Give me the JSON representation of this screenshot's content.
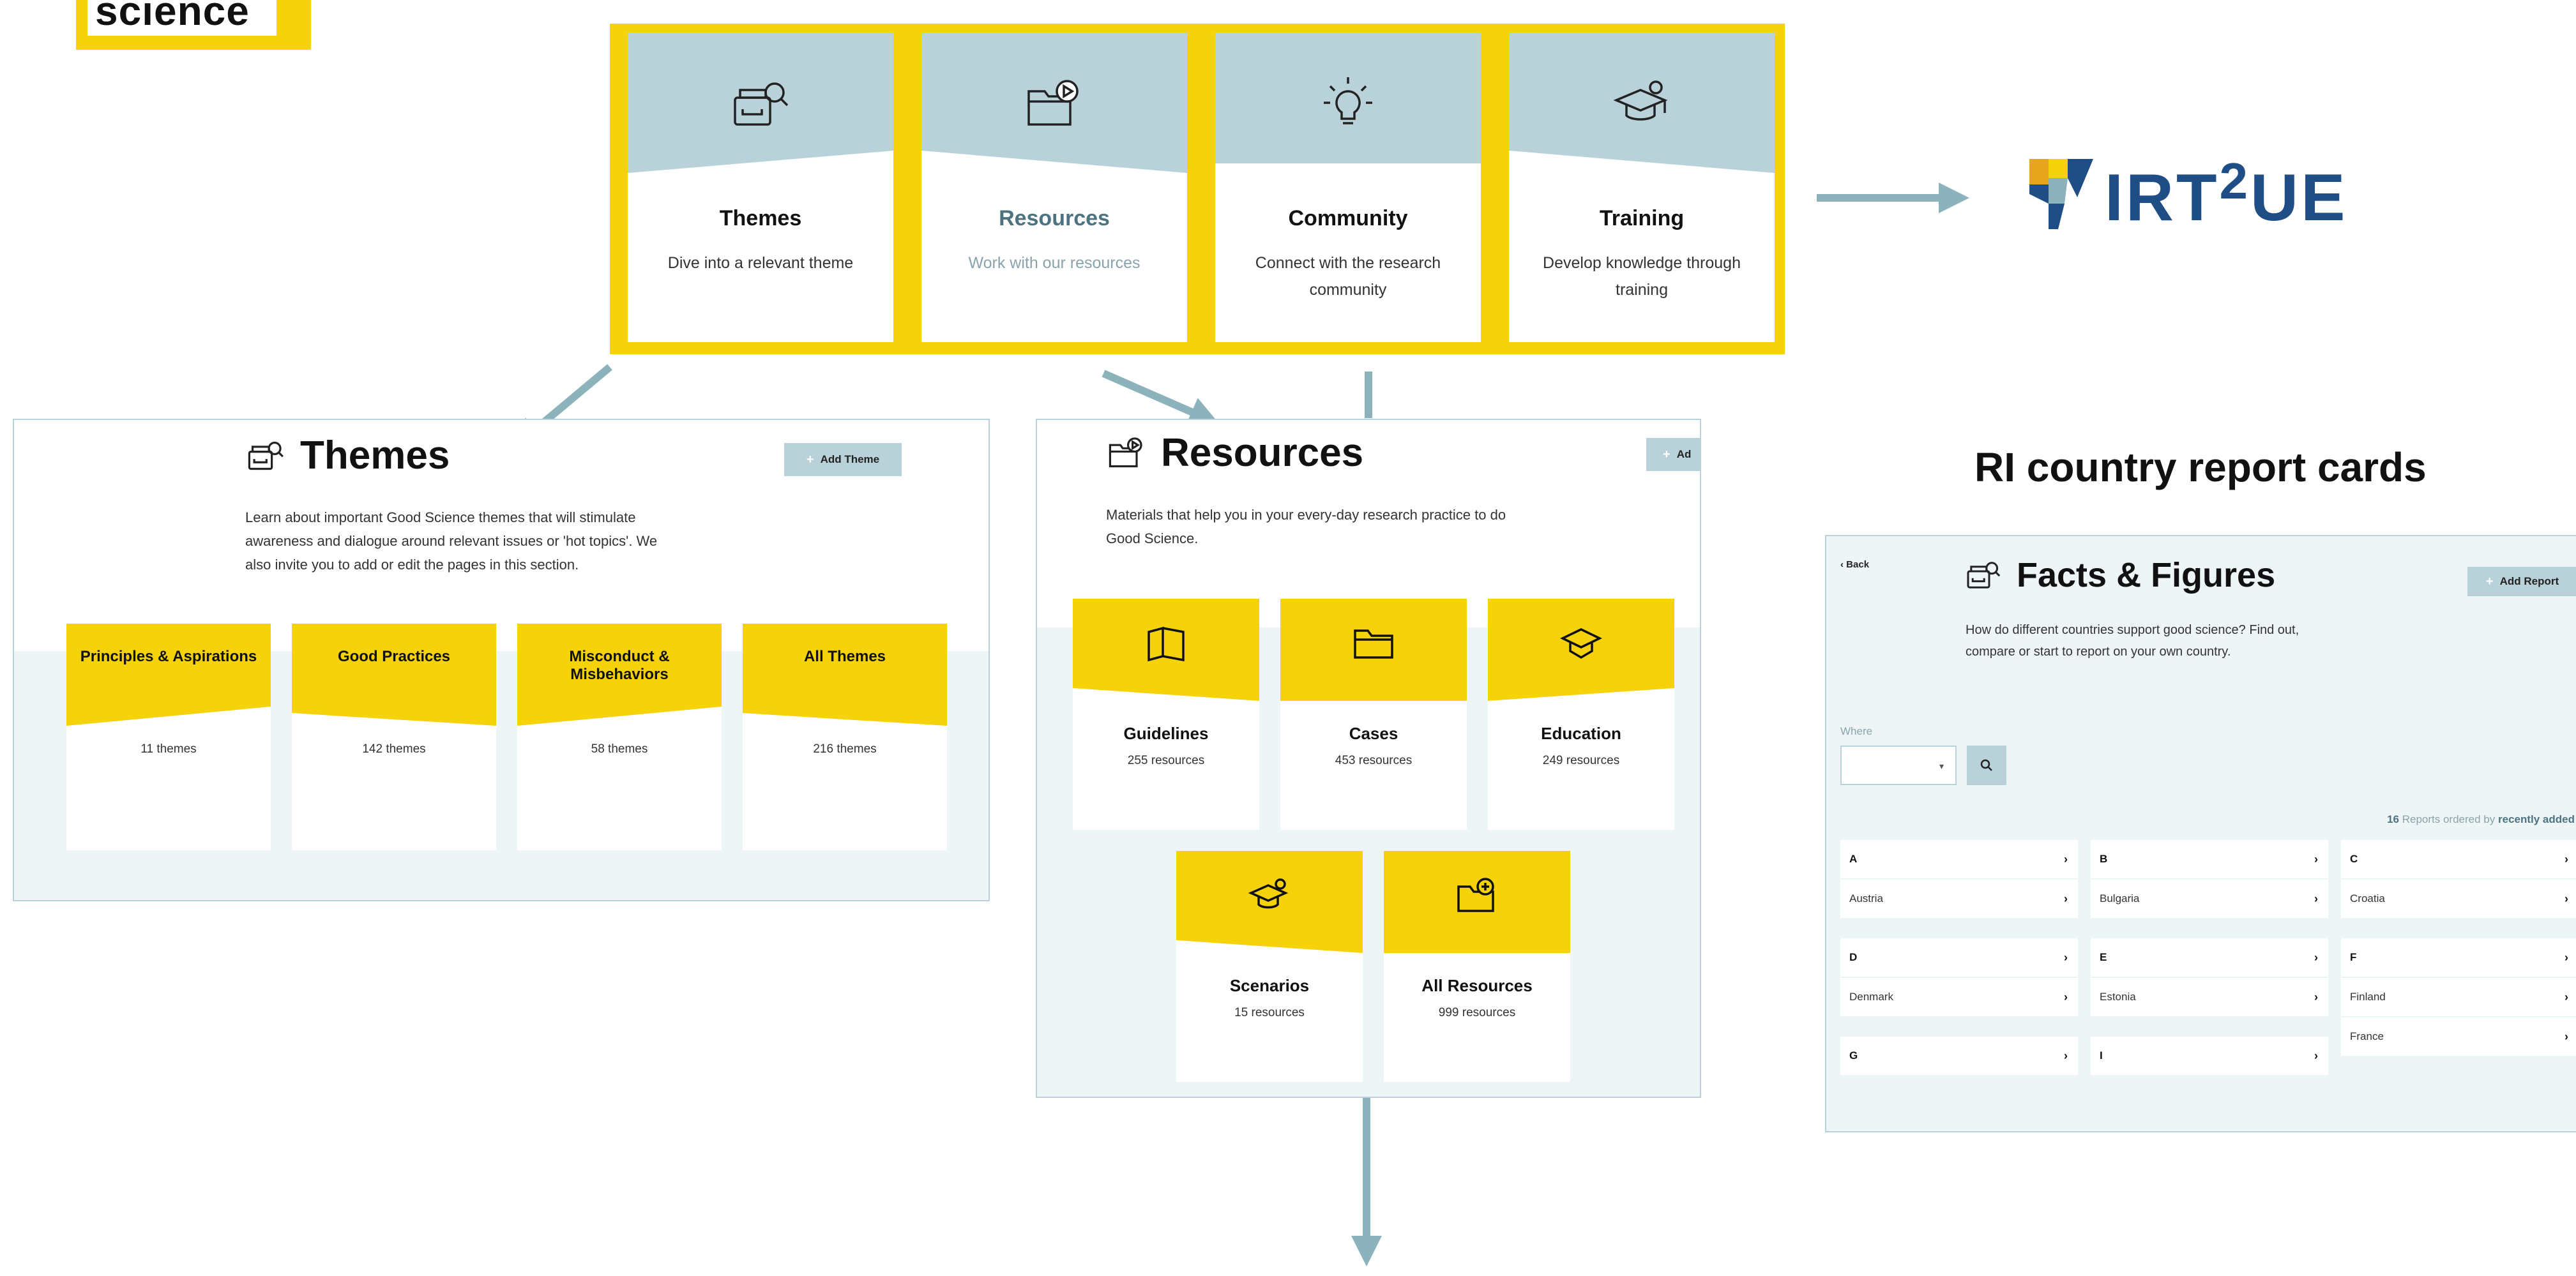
{
  "logo": {
    "text": "science"
  },
  "nav": {
    "cards": [
      {
        "title": "Themes",
        "desc": "Dive into a relevant theme",
        "icon": "drawer-search-icon",
        "active": false
      },
      {
        "title": "Resources",
        "desc": "Work with our resources",
        "icon": "folder-play-icon",
        "active": true
      },
      {
        "title": "Community",
        "desc": "Connect with the research community",
        "icon": "lightbulb-icon",
        "active": false
      },
      {
        "title": "Training",
        "desc": "Develop knowledge through training",
        "icon": "graduation-cap-icon",
        "active": false
      }
    ]
  },
  "virt2ue": {
    "word": "IRT",
    "sup": "2",
    "tail": "UE"
  },
  "ri_title": "RI country report cards",
  "themes_page": {
    "title": "Themes",
    "add_label": "Add Theme",
    "intro": "Learn about important Good Science themes that will stimulate awareness and dialogue around relevant issues or 'hot topics'. We also invite you to add or edit the pages in this section.",
    "cards": [
      {
        "title": "Principles & Aspirations",
        "count": "11 themes"
      },
      {
        "title": "Good Practices",
        "count": "142 themes"
      },
      {
        "title": "Misconduct & Misbehaviors",
        "count": "58 themes"
      },
      {
        "title": "All Themes",
        "count": "216 themes"
      }
    ]
  },
  "resources_page": {
    "title": "Resources",
    "add_label": "Ad",
    "intro": "Materials that help you in your every-day research practice to do Good Science.",
    "cards": [
      {
        "title": "Guidelines",
        "count": "255 resources",
        "icon": "book-icon"
      },
      {
        "title": "Cases",
        "count": "453 resources",
        "icon": "folder-icon"
      },
      {
        "title": "Education",
        "count": "249 resources",
        "icon": "mortarboard-icon"
      },
      {
        "title": "Scenarios",
        "count": "15 resources",
        "icon": "graduation-cap-icon"
      },
      {
        "title": "All Resources",
        "count": "999 resources",
        "icon": "folder-plus-icon"
      }
    ]
  },
  "facts_page": {
    "back": "Back",
    "title": "Facts & Figures",
    "add_label": "Add Report",
    "intro": "How do different countries support good science? Find out, compare or start to report on your own country.",
    "where_label": "Where",
    "count": "16",
    "count_text": "Reports ordered by",
    "order": "recently added",
    "columns": [
      [
        {
          "letter": "A",
          "items": [
            "Austria"
          ]
        },
        {
          "letter": "D",
          "items": [
            "Denmark"
          ]
        },
        {
          "letter": "G",
          "items": []
        }
      ],
      [
        {
          "letter": "B",
          "items": [
            "Bulgaria"
          ]
        },
        {
          "letter": "E",
          "items": [
            "Estonia"
          ]
        },
        {
          "letter": "I",
          "items": []
        }
      ],
      [
        {
          "letter": "C",
          "items": [
            "Croatia"
          ]
        },
        {
          "letter": "F",
          "items": [
            "Finland",
            "France"
          ]
        }
      ]
    ]
  },
  "colors": {
    "yellow": "#f5d20a",
    "band": "#b9d2da",
    "light": "#edf5f7",
    "arrow": "#8cb3bb",
    "navy": "#1f4d86"
  }
}
